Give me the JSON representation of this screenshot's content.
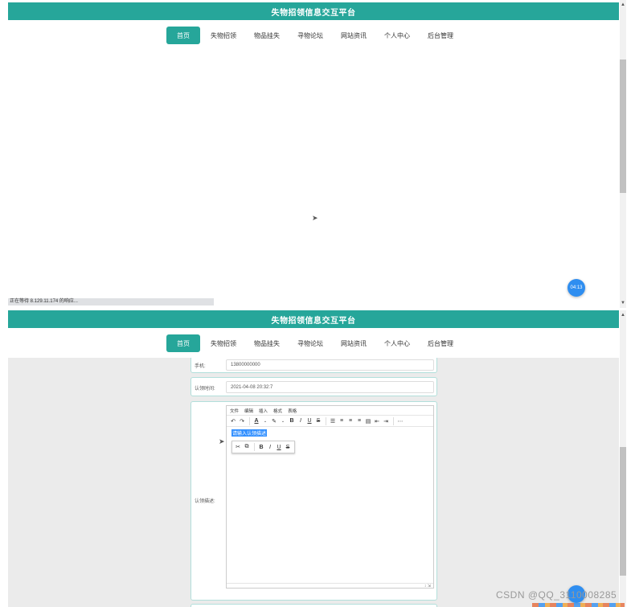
{
  "app": {
    "title": "失物招领信息交互平台"
  },
  "nav": {
    "items": [
      {
        "label": "首页",
        "active": true
      },
      {
        "label": "失物招领",
        "active": false
      },
      {
        "label": "物品挂失",
        "active": false
      },
      {
        "label": "寻物论坛",
        "active": false
      },
      {
        "label": "网站资讯",
        "active": false
      },
      {
        "label": "个人中心",
        "active": false
      },
      {
        "label": "后台管理",
        "active": false
      }
    ]
  },
  "status_bar": {
    "text": "正在等待 8.129.11.174 的响应..."
  },
  "float_button": {
    "label": "04:13"
  },
  "form": {
    "phone": {
      "label": "手机:",
      "value": "13800000000"
    },
    "claim_time": {
      "label": "认领时间:",
      "value": "2021-04-08 20:32:7"
    },
    "description": {
      "label": "认领描述:",
      "placeholder": "请输入认领描述",
      "menu": [
        "文件",
        "编辑",
        "插入",
        "格式",
        "表格"
      ],
      "toolbar_icons": [
        "undo-icon",
        "redo-icon",
        "font-color-icon",
        "highlight-icon",
        "bold-icon",
        "italic-icon",
        "underline-icon",
        "strikethrough-icon",
        "list-icon",
        "align-left-icon",
        "align-center-icon",
        "align-right-icon",
        "justify-icon",
        "outdent-icon",
        "indent-icon",
        "more-icon"
      ],
      "inline_toolbar_icons": [
        "cut-icon",
        "copy-icon",
        "bold-icon",
        "italic-icon",
        "underline-icon",
        "strikethrough-icon"
      ],
      "resize_indicator": "↕ ⇲"
    }
  },
  "watermark": {
    "text": "CSDN @QQ_3110008285"
  },
  "colors": {
    "primary": "#26a69a",
    "float": "#2f8ef0"
  }
}
